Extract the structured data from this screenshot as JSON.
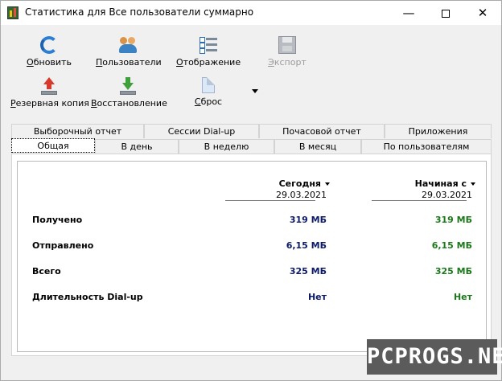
{
  "window": {
    "title": "Статистика для Все пользователи суммарно"
  },
  "toolbar": {
    "refresh": {
      "hotkey": "О",
      "rest": "бновить",
      "icon": "refresh-icon"
    },
    "users": {
      "hotkey": "П",
      "rest": "ользователи",
      "icon": "users-icon"
    },
    "display": {
      "hotkey": "О",
      "rest": "тображение",
      "icon": "view-list-icon"
    },
    "export": {
      "hotkey": "Э",
      "rest": "кспорт",
      "icon": "save-disk-icon",
      "enabled": false
    },
    "backup": {
      "hotkey": "Р",
      "rest": "езервная копия",
      "icon": "backup-arrow-up-icon"
    },
    "restore": {
      "hotkey": "В",
      "rest": "осстановление",
      "icon": "restore-arrow-down-icon"
    },
    "reset": {
      "hotkey": "С",
      "rest": "брос",
      "icon": "reset-page-icon"
    }
  },
  "tabs": {
    "row_back": [
      "Выборочный отчет",
      "Сессии Dial-up",
      "Почасовой отчет",
      "Приложения"
    ],
    "row_front": [
      "Общая",
      "В день",
      "В неделю",
      "В месяц",
      "По пользователям"
    ],
    "active": "Общая"
  },
  "columns": {
    "today": {
      "label": "Сегодня",
      "date": "29.03.2021"
    },
    "since": {
      "label": "Начиная с",
      "date": "29.03.2021"
    }
  },
  "rows": [
    {
      "label": "Получено",
      "today": "319 МБ",
      "since": "319 МБ"
    },
    {
      "label": "Отправлено",
      "today": "6,15 МБ",
      "since": "6,15 МБ"
    },
    {
      "label": "Всего",
      "today": "325 МБ",
      "since": "325 МБ"
    },
    {
      "label": "Длительность Dial-up",
      "today": "Нет",
      "since": "Нет"
    }
  ],
  "colors": {
    "today_value": "#0b1a6b",
    "since_value": "#1a7a1a"
  },
  "watermark": "PCPROGS.NET"
}
